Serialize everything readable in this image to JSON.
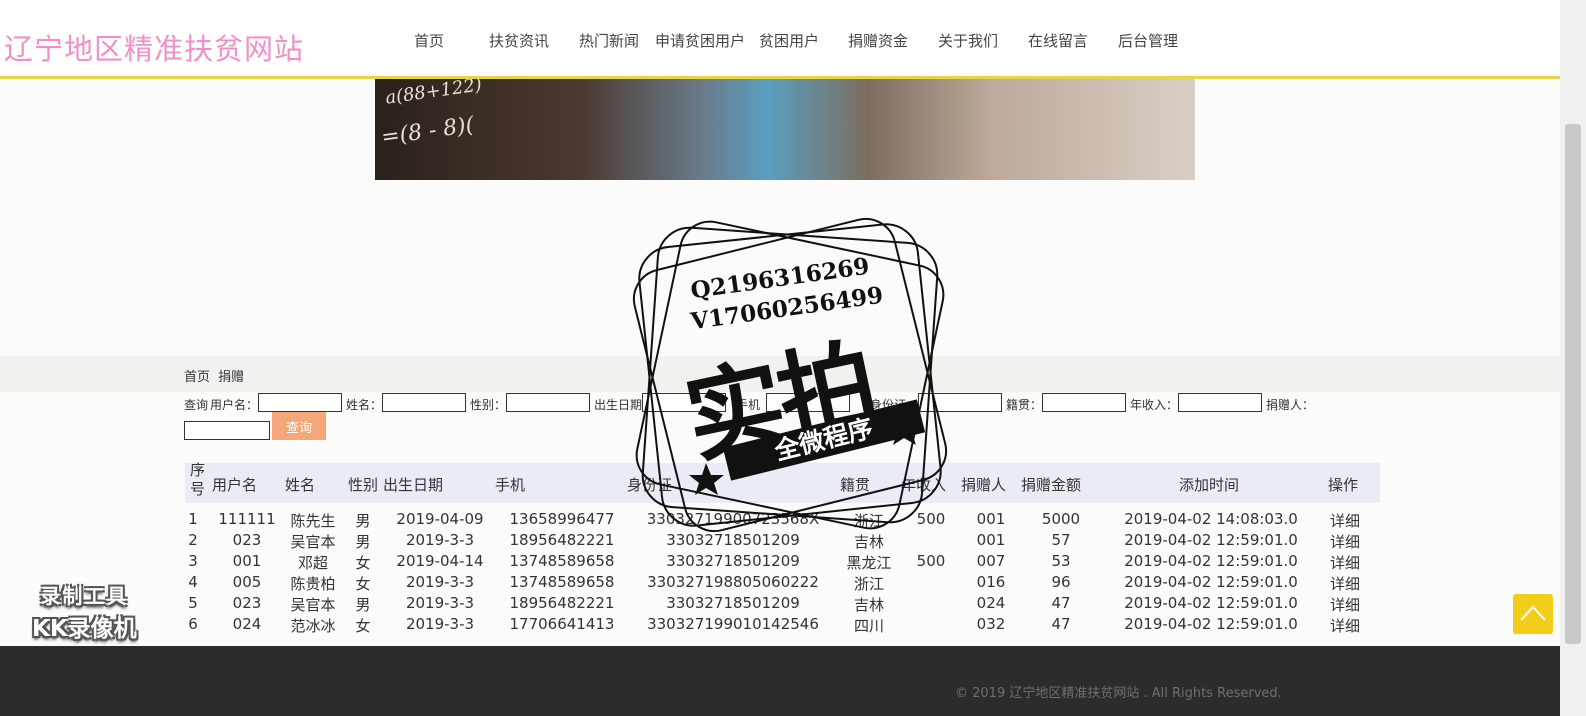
{
  "site": {
    "title": "辽宁地区精准扶贫网站"
  },
  "nav": [
    "首页",
    "扶贫资讯",
    "热门新闻",
    "申请贫困用户",
    "贫困用户",
    "捐赠资金",
    "关于我们",
    "在线留言",
    "后台管理"
  ],
  "banner": {
    "formula_top": "a(88+122)",
    "formula_bottom": "=(8 - 8)(",
    "image": "child-at-chalkboard-banner"
  },
  "breadcrumb": [
    "首页",
    "捐赠"
  ],
  "search": {
    "prefix": "查询",
    "fields": [
      "用户名：",
      "姓名：",
      "性别：",
      "出生日期",
      "手机",
      "身份证：",
      "籍贯：",
      "年收入：",
      "捐赠人："
    ],
    "button": "查询"
  },
  "table": {
    "headers": [
      "序号",
      "用户名",
      "姓名",
      "性别",
      "出生日期",
      "手机",
      "身份证",
      "籍贯",
      "年收入",
      "捐赠人",
      "捐赠金额",
      "添加时间",
      "操作"
    ],
    "rows": [
      [
        "1",
        "111111",
        "陈先生",
        "男",
        "2019-04-09",
        "13658996477",
        "33032719900723568X",
        "浙江",
        "500",
        "001",
        "5000",
        "2019-04-02 14:08:03.0",
        "详细"
      ],
      [
        "2",
        "023",
        "吴官本",
        "男",
        "2019-3-3",
        "18956482221",
        "33032718501209",
        "吉林",
        "",
        "001",
        "57",
        "2019-04-02 12:59:01.0",
        "详细"
      ],
      [
        "3",
        "001",
        "邓超",
        "女",
        "2019-04-14",
        "13748589658",
        "33032718501209",
        "黑龙江",
        "500",
        "007",
        "53",
        "2019-04-02 12:59:01.0",
        "详细"
      ],
      [
        "4",
        "005",
        "陈贵柏",
        "女",
        "2019-3-3",
        "13748589658",
        "330327198805060222",
        "浙江",
        "",
        "016",
        "96",
        "2019-04-02 12:59:01.0",
        "详细"
      ],
      [
        "5",
        "023",
        "吴官本",
        "男",
        "2019-3-3",
        "18956482221",
        "33032718501209",
        "吉林",
        "",
        "024",
        "47",
        "2019-04-02 12:59:01.0",
        "详细"
      ],
      [
        "6",
        "024",
        "范冰冰",
        "女",
        "2019-3-3",
        "17706641413",
        "330327199010142546",
        "四川",
        "",
        "032",
        "47",
        "2019-04-02 12:59:01.0",
        "详细"
      ]
    ]
  },
  "footer": {
    "copyright": "© 2019 辽宁地区精准扶贫网站 . All Rights Reserved."
  },
  "watermark": {
    "line1": "Q2196316269",
    "line2": "V17060256499",
    "main": "实拍",
    "sub": "全微程序"
  },
  "recorder": {
    "line1": "录制工具",
    "line2": "KK录像机"
  },
  "colors": {
    "title": "#f08fc8",
    "header_border": "#e8d44a",
    "button": "#f5a77a",
    "table_header": "#e9ecf5",
    "footer": "#2c2c2c",
    "back_to_top": "#f2cd1a"
  }
}
